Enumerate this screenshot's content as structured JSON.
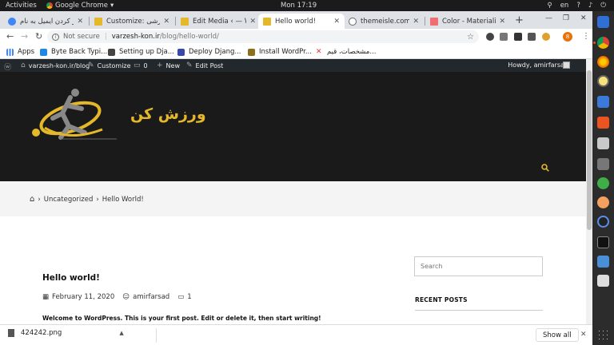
{
  "topbar": {
    "activities": "Activities",
    "app_name": "Google Chrome",
    "clock": "Mon 17:19",
    "lang": "en"
  },
  "tabs": [
    {
      "title": "باز کردن ایمیل به نام",
      "active": false,
      "color": "#3f87f5"
    },
    {
      "title": "Customize: ورزشی",
      "active": false,
      "color": "#e5b829"
    },
    {
      "title": "Edit Media ‹ — Wo",
      "active": false,
      "color": "#e5b829"
    },
    {
      "title": "Hello world!",
      "active": true,
      "color": "#e5b829"
    },
    {
      "title": "themeisle.com",
      "active": false,
      "color": "#666666"
    },
    {
      "title": "Color - Materialize",
      "active": false,
      "color": "#ee6e73"
    }
  ],
  "omnibox": {
    "not_secure": "Not secure",
    "host": "varzesh-kon.ir",
    "path": "/blog/hello-world/"
  },
  "bookmarks": [
    {
      "label": "Apps",
      "color": "#4285f4"
    },
    {
      "label": "Byte Back Typi...",
      "color": "#1e88e5"
    },
    {
      "label": "Setting up Dja...",
      "color": "#444444"
    },
    {
      "label": "Deploy Djang...",
      "color": "#3949ab"
    },
    {
      "label": "Install WordPr...",
      "color": "#8d6e1a"
    },
    {
      "label": "مشخصات، قیم...",
      "color": "#e53935"
    }
  ],
  "adminbar": {
    "site": "varzesh-kon.ir/blog",
    "customize": "Customize",
    "comments": "0",
    "new": "New",
    "edit": "Edit Post",
    "howdy": "Howdy, amirfarsad"
  },
  "site": {
    "logo_text": "ورزش کن",
    "accent": "#e5b829"
  },
  "breadcrumb": {
    "category": "Uncategorized",
    "current": "Hello World!"
  },
  "post": {
    "title": "Hello world!",
    "date": "February 11, 2020",
    "author": "amirfarsad",
    "comments": "1",
    "excerpt": "Welcome to WordPress. This is your first post. Edit or delete it, then start writing!"
  },
  "sidebar": {
    "search_placeholder": "Search",
    "recent_posts": "RECENT POSTS"
  },
  "downloads": {
    "file": "424242.png",
    "show_all": "Show all"
  }
}
